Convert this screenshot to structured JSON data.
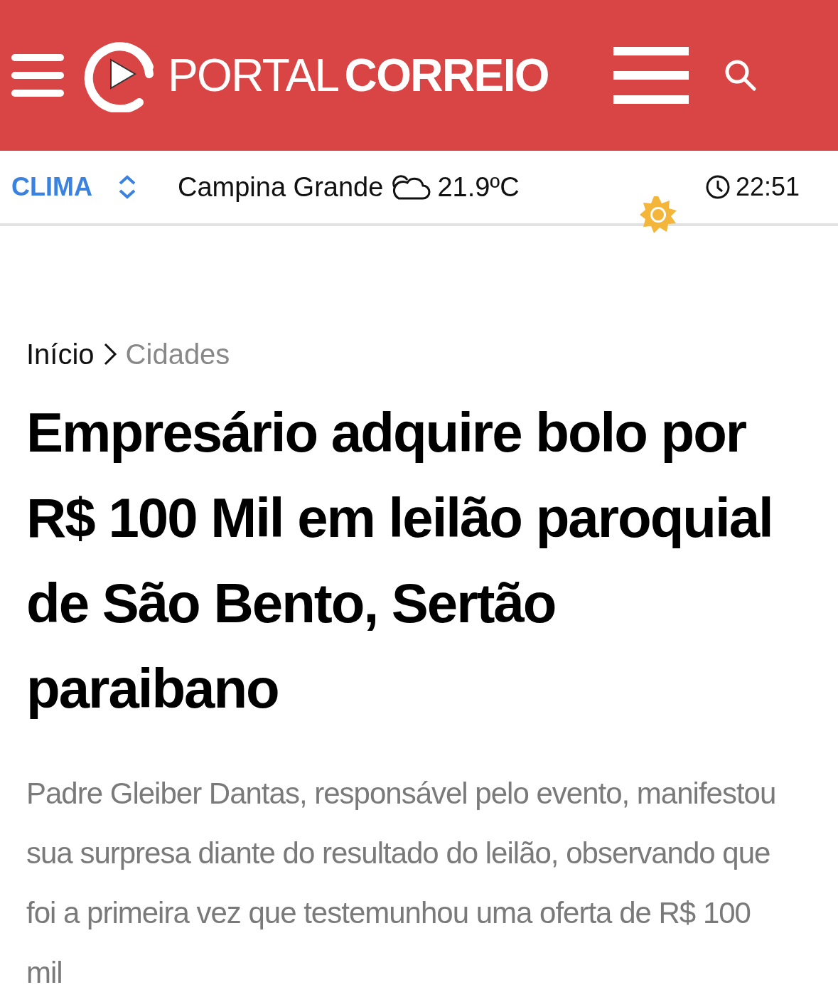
{
  "header": {
    "logo_light": "PORTAL",
    "logo_bold": "CORREIO"
  },
  "weather_bar": {
    "label": "CLIMA",
    "city": "Campina Grande",
    "temperature": "21.9ºC",
    "time": "22:51"
  },
  "breadcrumb": [
    {
      "label": "Início",
      "selected": false
    },
    {
      "label": "Cidades",
      "selected": true
    }
  ],
  "article": {
    "headline": "Empresário adquire bolo por R$ 100 Mil em leilão paroquial de São Bento, Sertão paraibano",
    "lead": "Padre Gleiber Dantas, responsável pelo evento, manifestou sua surpresa diante do resultado do leilão, observando que foi a primeira vez que testemunhou uma oferta de R$ 100 mil"
  }
}
